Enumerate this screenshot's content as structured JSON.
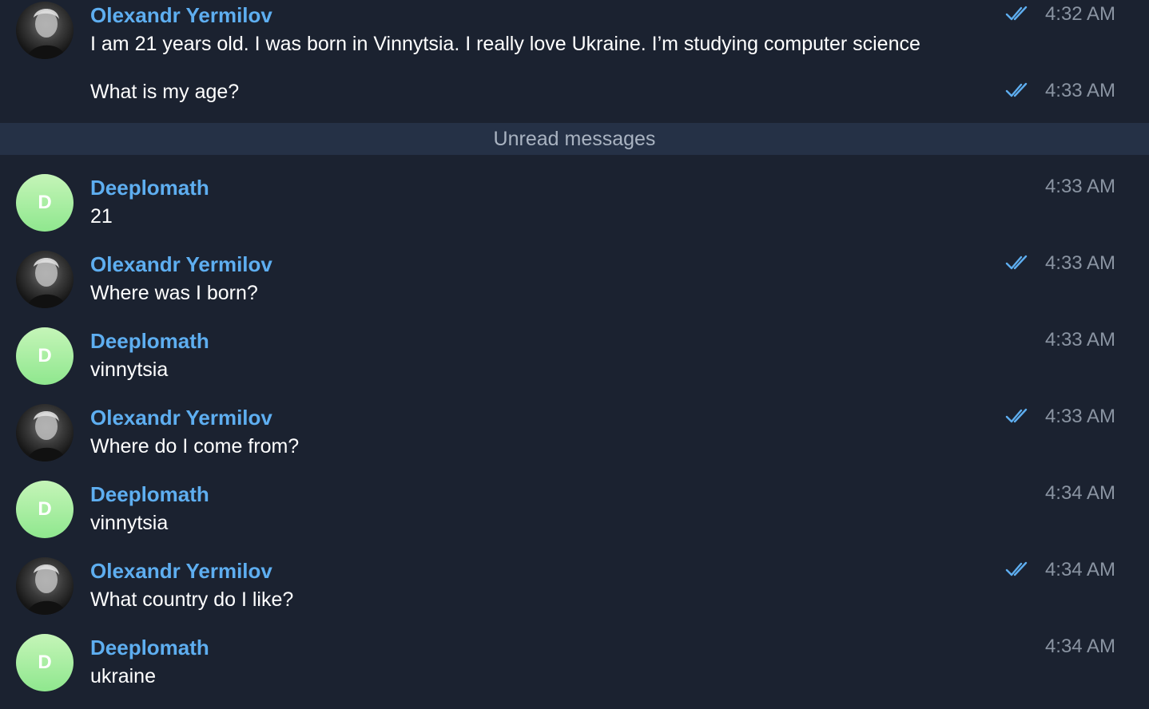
{
  "colors": {
    "background": "#1b2230",
    "author": "#5eaef0",
    "text": "#ffffff",
    "time": "#8a94a2",
    "check": "#5eaef0",
    "divider_bg": "#253146",
    "bot_avatar": "#a8ee9e"
  },
  "divider": {
    "label": "Unread messages"
  },
  "messages": [
    {
      "author": "Olexandr Yermilov",
      "avatar": "photo",
      "text": "I am 21 years old. I was born in Vinnytsia. I really love Ukraine. I’m studying computer science",
      "time": "4:32 AM",
      "read_icon": "double-check-icon"
    },
    {
      "author": "",
      "text": "What is my age?",
      "time": "4:33 AM",
      "read_icon": "double-check-icon"
    },
    {
      "author": "Deeplomath",
      "avatar": "D",
      "text": "21",
      "time": "4:33 AM"
    },
    {
      "author": "Olexandr Yermilov",
      "avatar": "photo",
      "text": "Where was I born?",
      "time": "4:33 AM",
      "read_icon": "double-check-icon"
    },
    {
      "author": "Deeplomath",
      "avatar": "D",
      "text": "vinnytsia",
      "time": "4:33 AM"
    },
    {
      "author": "Olexandr Yermilov",
      "avatar": "photo",
      "text": "Where do I come from?",
      "time": "4:33 AM",
      "read_icon": "double-check-icon"
    },
    {
      "author": "Deeplomath",
      "avatar": "D",
      "text": "vinnytsia",
      "time": "4:34 AM"
    },
    {
      "author": "Olexandr Yermilov",
      "avatar": "photo",
      "text": "What country do I like?",
      "time": "4:34 AM",
      "read_icon": "double-check-icon"
    },
    {
      "author": "Deeplomath",
      "avatar": "D",
      "text": "ukraine",
      "time": "4:34 AM"
    }
  ]
}
